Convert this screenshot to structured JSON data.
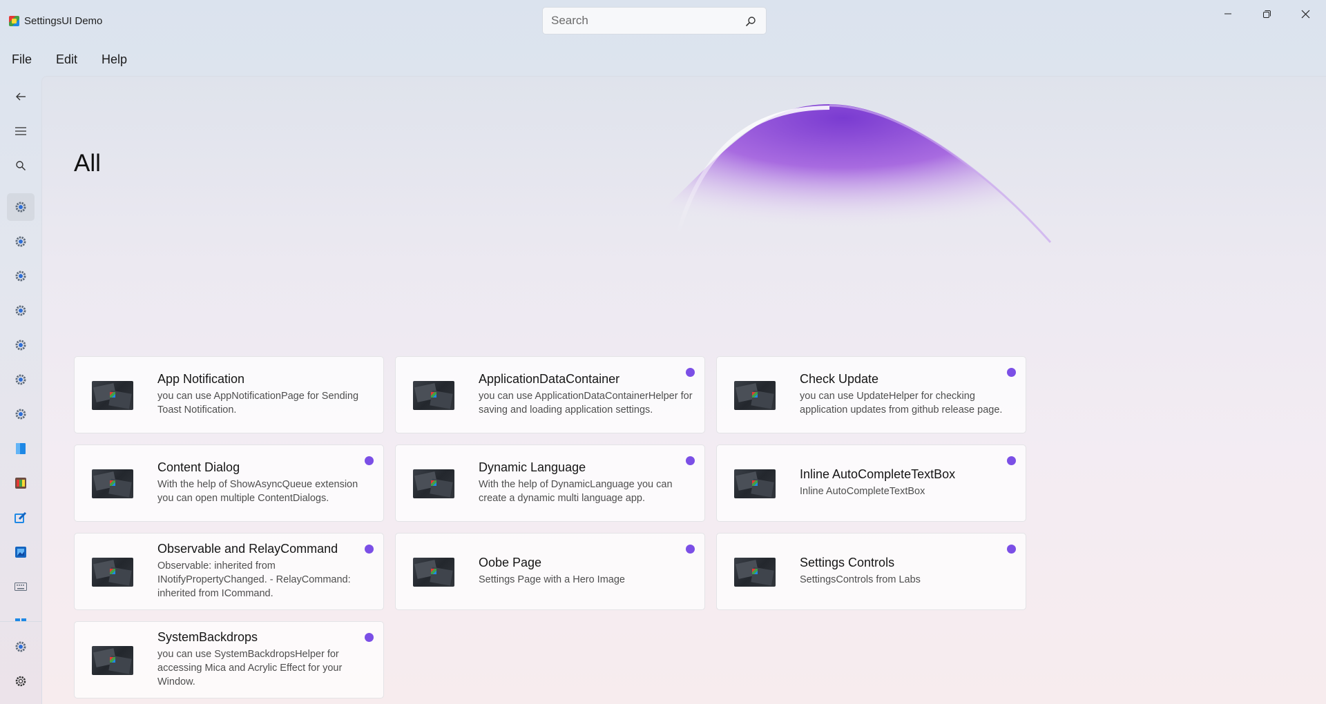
{
  "app": {
    "title": "SettingsUI Demo"
  },
  "search": {
    "placeholder": "Search",
    "value": ""
  },
  "menu": {
    "items": [
      "File",
      "Edit",
      "Help"
    ]
  },
  "page": {
    "title": "All"
  },
  "accent_color": "#7b4fe6",
  "nav": {
    "top_icons": [
      "back-arrow-icon",
      "hamburger-menu-icon",
      "search-icon"
    ],
    "items_icons": [
      "gear-icon",
      "gear-icon",
      "gear-icon",
      "gear-icon",
      "gear-icon",
      "gear-icon",
      "gear-icon",
      "blue-app-icon",
      "colorful-app-icon",
      "edit-icon",
      "photos-icon",
      "keyboard-icon",
      "windows-icon"
    ],
    "bottom_icons": [
      "gear-icon",
      "settings-icon"
    ]
  },
  "cards": [
    {
      "title": "App Notification",
      "description": "you can use AppNotificationPage for Sending Toast Notification.",
      "badge": false
    },
    {
      "title": "ApplicationDataContainer",
      "description": "you can use ApplicationDataContainerHelper for saving and loading application settings.",
      "badge": true
    },
    {
      "title": "Check Update",
      "description": "you can use UpdateHelper for checking application updates from github release page.",
      "badge": true
    },
    {
      "title": "Content Dialog",
      "description": "With the help of ShowAsyncQueue extension you can open multiple ContentDialogs.",
      "badge": true
    },
    {
      "title": "Dynamic Language",
      "description": "With the help of DynamicLanguage you can create a dynamic multi language app.",
      "badge": true
    },
    {
      "title": "Inline AutoCompleteTextBox",
      "description": "Inline AutoCompleteTextBox",
      "badge": true
    },
    {
      "title": "Observable and RelayCommand",
      "description": "Observable: inherited from INotifyPropertyChanged. - RelayCommand: inherited from ICommand.",
      "badge": true
    },
    {
      "title": "Oobe Page",
      "description": "Settings Page with a Hero Image",
      "badge": true
    },
    {
      "title": "Settings Controls",
      "description": "SettingsControls from Labs",
      "badge": true
    },
    {
      "title": "SystemBackdrops",
      "description": "you can use SystemBackdropsHelper for accessing Mica and Acrylic Effect for your Window.",
      "badge": true
    }
  ]
}
